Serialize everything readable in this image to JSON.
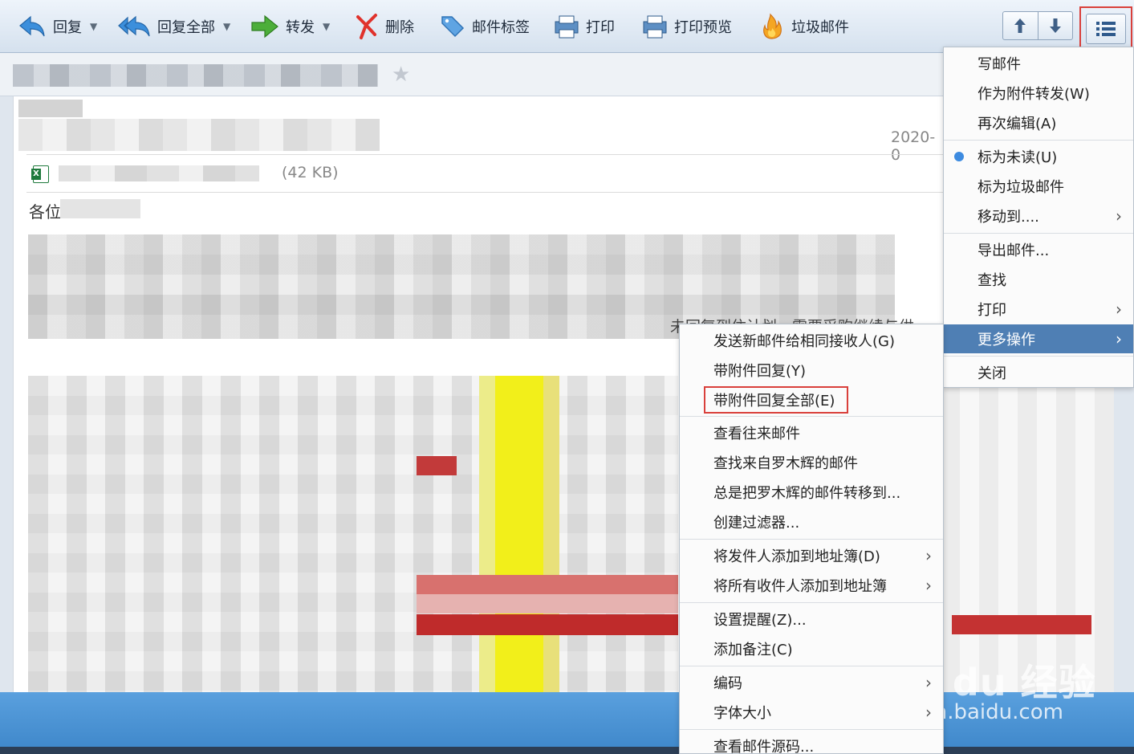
{
  "toolbar": {
    "reply": "回复",
    "reply_all": "回复全部",
    "forward": "转发",
    "delete": "删除",
    "tag": "邮件标签",
    "print": "打印",
    "print_preview": "打印预览",
    "junk": "垃圾邮件"
  },
  "mail": {
    "date": "2020-0",
    "attachment_size": "(42 KB)",
    "greeting": "各位",
    "body_snippet": "未回复到住计划，需要采购继续与供"
  },
  "main_menu": {
    "items": [
      {
        "label": "写邮件"
      },
      {
        "label": "作为附件转发(W)"
      },
      {
        "label": "再次编辑(A)"
      },
      {
        "label": "标为未读(U)"
      },
      {
        "label": "标为垃圾邮件"
      },
      {
        "label": "移动到...."
      },
      {
        "label": "导出邮件..."
      },
      {
        "label": "查找"
      },
      {
        "label": "打印"
      },
      {
        "label": "更多操作"
      },
      {
        "label": "关闭"
      }
    ]
  },
  "sub_menu": {
    "items": [
      {
        "label": "发送新邮件给相同接收人(G)"
      },
      {
        "label": "带附件回复(Y)"
      },
      {
        "label": "带附件回复全部(E)"
      },
      {
        "label": "查看往来邮件"
      },
      {
        "label": "查找来自罗木辉的邮件"
      },
      {
        "label": "总是把罗木辉的邮件转移到..."
      },
      {
        "label": "创建过滤器..."
      },
      {
        "label": "将发件人添加到地址簿(D)"
      },
      {
        "label": "将所有收件人添加到地址簿"
      },
      {
        "label": "设置提醒(Z)..."
      },
      {
        "label": "添加备注(C)"
      },
      {
        "label": "编码"
      },
      {
        "label": "字体大小"
      },
      {
        "label": "查看邮件源码..."
      }
    ]
  },
  "watermark": {
    "brand": "Bai du 经验",
    "url": "jingyan.baidu.com"
  },
  "colors": {
    "accent": "#4f7fb4",
    "highlight": "#d9403b",
    "radio": "#3d8be0"
  }
}
